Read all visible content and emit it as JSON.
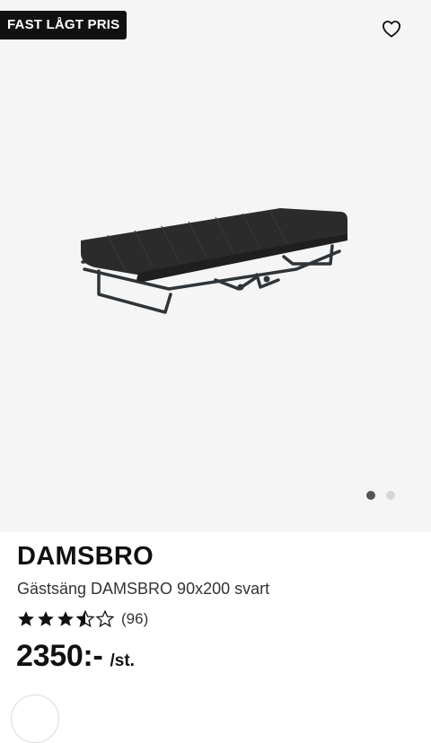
{
  "badge": {
    "label": "FAST LÅGT PRIS"
  },
  "actions": {
    "favorite_icon": "heart-outline-icon"
  },
  "gallery": {
    "image": "folding-guest-bed-image",
    "total_images": 2,
    "active_index": 0
  },
  "product": {
    "name": "DAMSBRO",
    "description": "Gästsäng DAMSBRO 90x200 svart",
    "rating": {
      "value": 3.5,
      "max": 5,
      "count_label": "(96)"
    },
    "price": {
      "amount": "2350:-",
      "unit": "/st."
    }
  }
}
